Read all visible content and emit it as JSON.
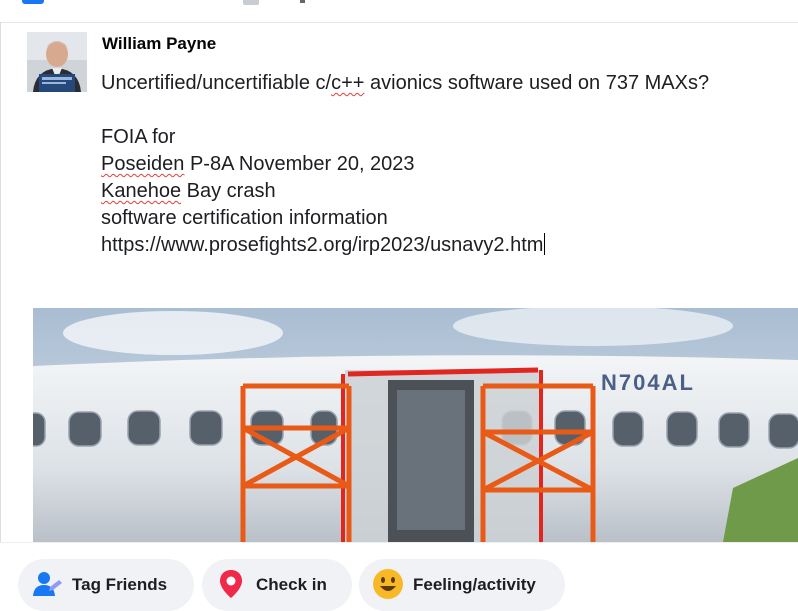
{
  "post": {
    "author": "William Payne",
    "lines": [
      "Uncertified/uncertifiable c/c++ avionics software used on 737 MAXs?",
      "",
      "FOIA for",
      "Poseiden P-8A November 20, 2023",
      "Kanehoe Bay crash",
      "software certification information",
      "https://www.prosefights2.org/irp2023/usnavy2.htm"
    ],
    "spell_words": [
      "c++",
      "Poseiden",
      "Kanehoe"
    ]
  },
  "photo": {
    "registration": "N704AL"
  },
  "actions": [
    {
      "label": "Tag Friends",
      "icon": "tag-friends-icon",
      "color": "#1877f2"
    },
    {
      "label": "Check in",
      "icon": "location-pin-icon",
      "color": "#f02849"
    },
    {
      "label": "Feeling/activity",
      "icon": "smiley-icon",
      "color": "#f7b928"
    }
  ]
}
